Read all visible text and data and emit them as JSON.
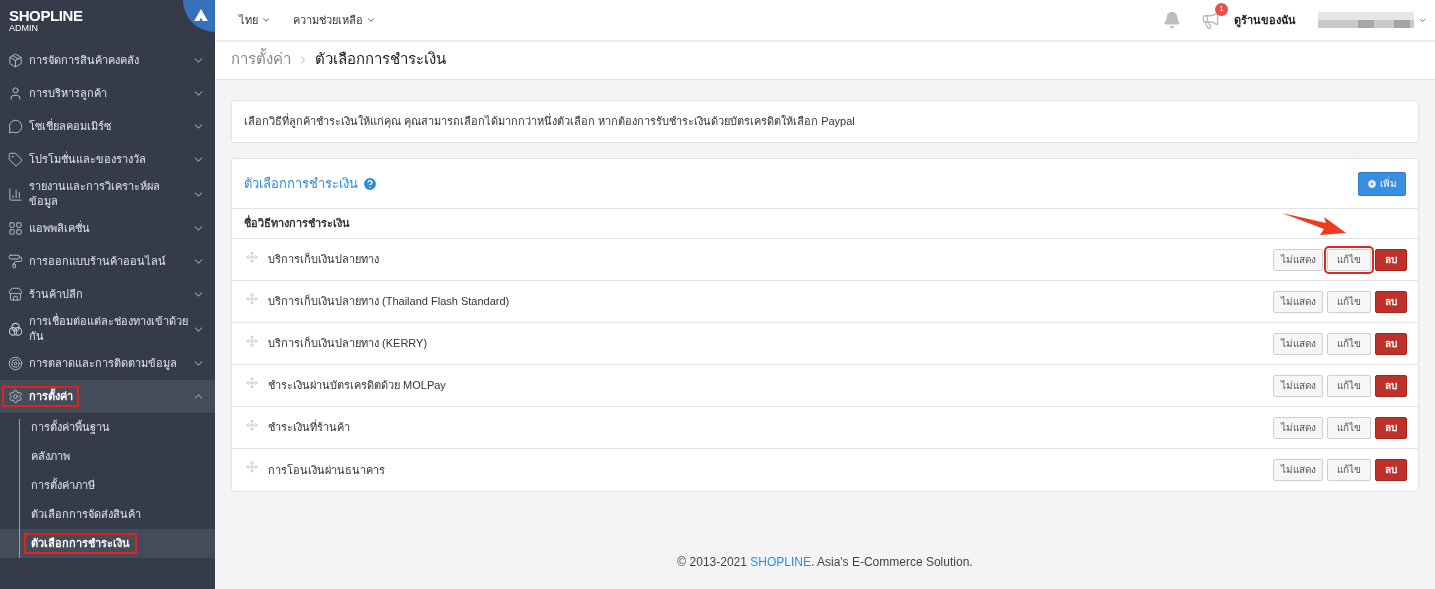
{
  "sidebar": {
    "logo": {
      "brand": "SHOPLINE",
      "sub": "ADMIN"
    },
    "items": [
      {
        "label": "การจัดการสินค้าคงคลัง",
        "expanded": false,
        "highlighted": false
      },
      {
        "label": "การบริหารลูกค้า",
        "expanded": false,
        "highlighted": false
      },
      {
        "label": "โซเชี่ยลคอมเมิร์ซ",
        "expanded": false,
        "highlighted": false
      },
      {
        "label": "โปรโมชั่นและของรางวัล",
        "expanded": false,
        "highlighted": false
      },
      {
        "label": "รายงานและการวิเคราะห์ผลข้อมูล",
        "expanded": false,
        "highlighted": false
      },
      {
        "label": "แอพพลิเคชั่น",
        "expanded": false,
        "highlighted": false
      },
      {
        "label": "การออกแบบร้านค้าออนไลน์",
        "expanded": false,
        "highlighted": false
      },
      {
        "label": "ร้านค้าปลีก",
        "expanded": false,
        "highlighted": false
      },
      {
        "label": "การเชื่อมต่อแต่ละช่องทางเข้าด้วยกัน",
        "expanded": false,
        "highlighted": false
      },
      {
        "label": "การตลาดและการติดตามข้อมูล",
        "expanded": false,
        "highlighted": false
      },
      {
        "label": "การตั้งค่า",
        "expanded": true,
        "highlighted": true,
        "children": [
          {
            "label": "การตั้งค่าพื้นฐาน",
            "selected": false,
            "highlighted": false
          },
          {
            "label": "คลังภาพ",
            "selected": false,
            "highlighted": false
          },
          {
            "label": "การตั้งค่าภาษี",
            "selected": false,
            "highlighted": false
          },
          {
            "label": "ตัวเลือกการจัดส่งสินค้า",
            "selected": false,
            "highlighted": false
          },
          {
            "label": "ตัวเลือกการชำระเงิน",
            "selected": true,
            "highlighted": true
          }
        ]
      }
    ]
  },
  "header": {
    "menus": [
      {
        "label": "ไทย"
      },
      {
        "label": "ความช่วยเหลือ"
      }
    ],
    "announcement_badge": "1",
    "store_link": "ดูร้านของฉัน"
  },
  "breadcrumb": [
    "การตั้งค่า",
    "ตัวเลือกการชำระเงิน"
  ],
  "info": "เลือกวิธีที่ลูกค้าชำระเงินให้แก่คุณ คุณสามารถเลือกได้มากกว่าหนึ่งตัวเลือก หากต้องการรับชำระเงินด้วยบัตรเครดิตให้เลือก Paypal",
  "panel": {
    "title": "ตัวเลือกการชำระเงิน",
    "add_button": "เพิ่ม",
    "column": "ชื่อวิธีทางการชำระเงิน",
    "rows": [
      {
        "name": "บริการเก็บเงินปลายทาง",
        "buttons": [
          {
            "kind": "hide",
            "label": "ไม่แสดง",
            "highlighted": false
          },
          {
            "kind": "edit",
            "label": "แก้ไข",
            "highlighted": true
          },
          {
            "kind": "delete",
            "label": "ลบ",
            "highlighted": false
          }
        ]
      },
      {
        "name": "บริการเก็บเงินปลายทาง (Thailand Flash Standard)",
        "buttons": [
          {
            "kind": "hide",
            "label": "ไม่แสดง",
            "highlighted": false
          },
          {
            "kind": "edit",
            "label": "แก้ไข",
            "highlighted": false
          },
          {
            "kind": "delete",
            "label": "ลบ",
            "highlighted": false
          }
        ]
      },
      {
        "name": "บริการเก็บเงินปลายทาง (KERRY)",
        "buttons": [
          {
            "kind": "hide",
            "label": "ไม่แสดง",
            "highlighted": false
          },
          {
            "kind": "edit",
            "label": "แก้ไข",
            "highlighted": false
          },
          {
            "kind": "delete",
            "label": "ลบ",
            "highlighted": false
          }
        ]
      },
      {
        "name": "ชำระเงินผ่านบัตรเครดิตด้วย MOLPay",
        "buttons": [
          {
            "kind": "hide",
            "label": "ไม่แสดง",
            "highlighted": false
          },
          {
            "kind": "edit",
            "label": "แก้ไข",
            "highlighted": false
          },
          {
            "kind": "delete",
            "label": "ลบ",
            "highlighted": false
          }
        ]
      },
      {
        "name": "ชำระเงินที่ร้านค้า",
        "buttons": [
          {
            "kind": "hide",
            "label": "ไม่แสดง",
            "highlighted": false
          },
          {
            "kind": "edit",
            "label": "แก้ไข",
            "highlighted": false
          },
          {
            "kind": "delete",
            "label": "ลบ",
            "highlighted": false
          }
        ]
      },
      {
        "name": "การโอนเงินผ่านธนาคาร",
        "buttons": [
          {
            "kind": "hide",
            "label": "ไม่แสดง",
            "highlighted": false
          },
          {
            "kind": "edit",
            "label": "แก้ไข",
            "highlighted": false
          },
          {
            "kind": "delete",
            "label": "ลบ",
            "highlighted": false
          }
        ]
      }
    ]
  },
  "footer": {
    "prefix": "© 2013-2021 ",
    "brand": "SHOPLINE",
    "suffix": ". Asia's E-Commerce Solution."
  }
}
